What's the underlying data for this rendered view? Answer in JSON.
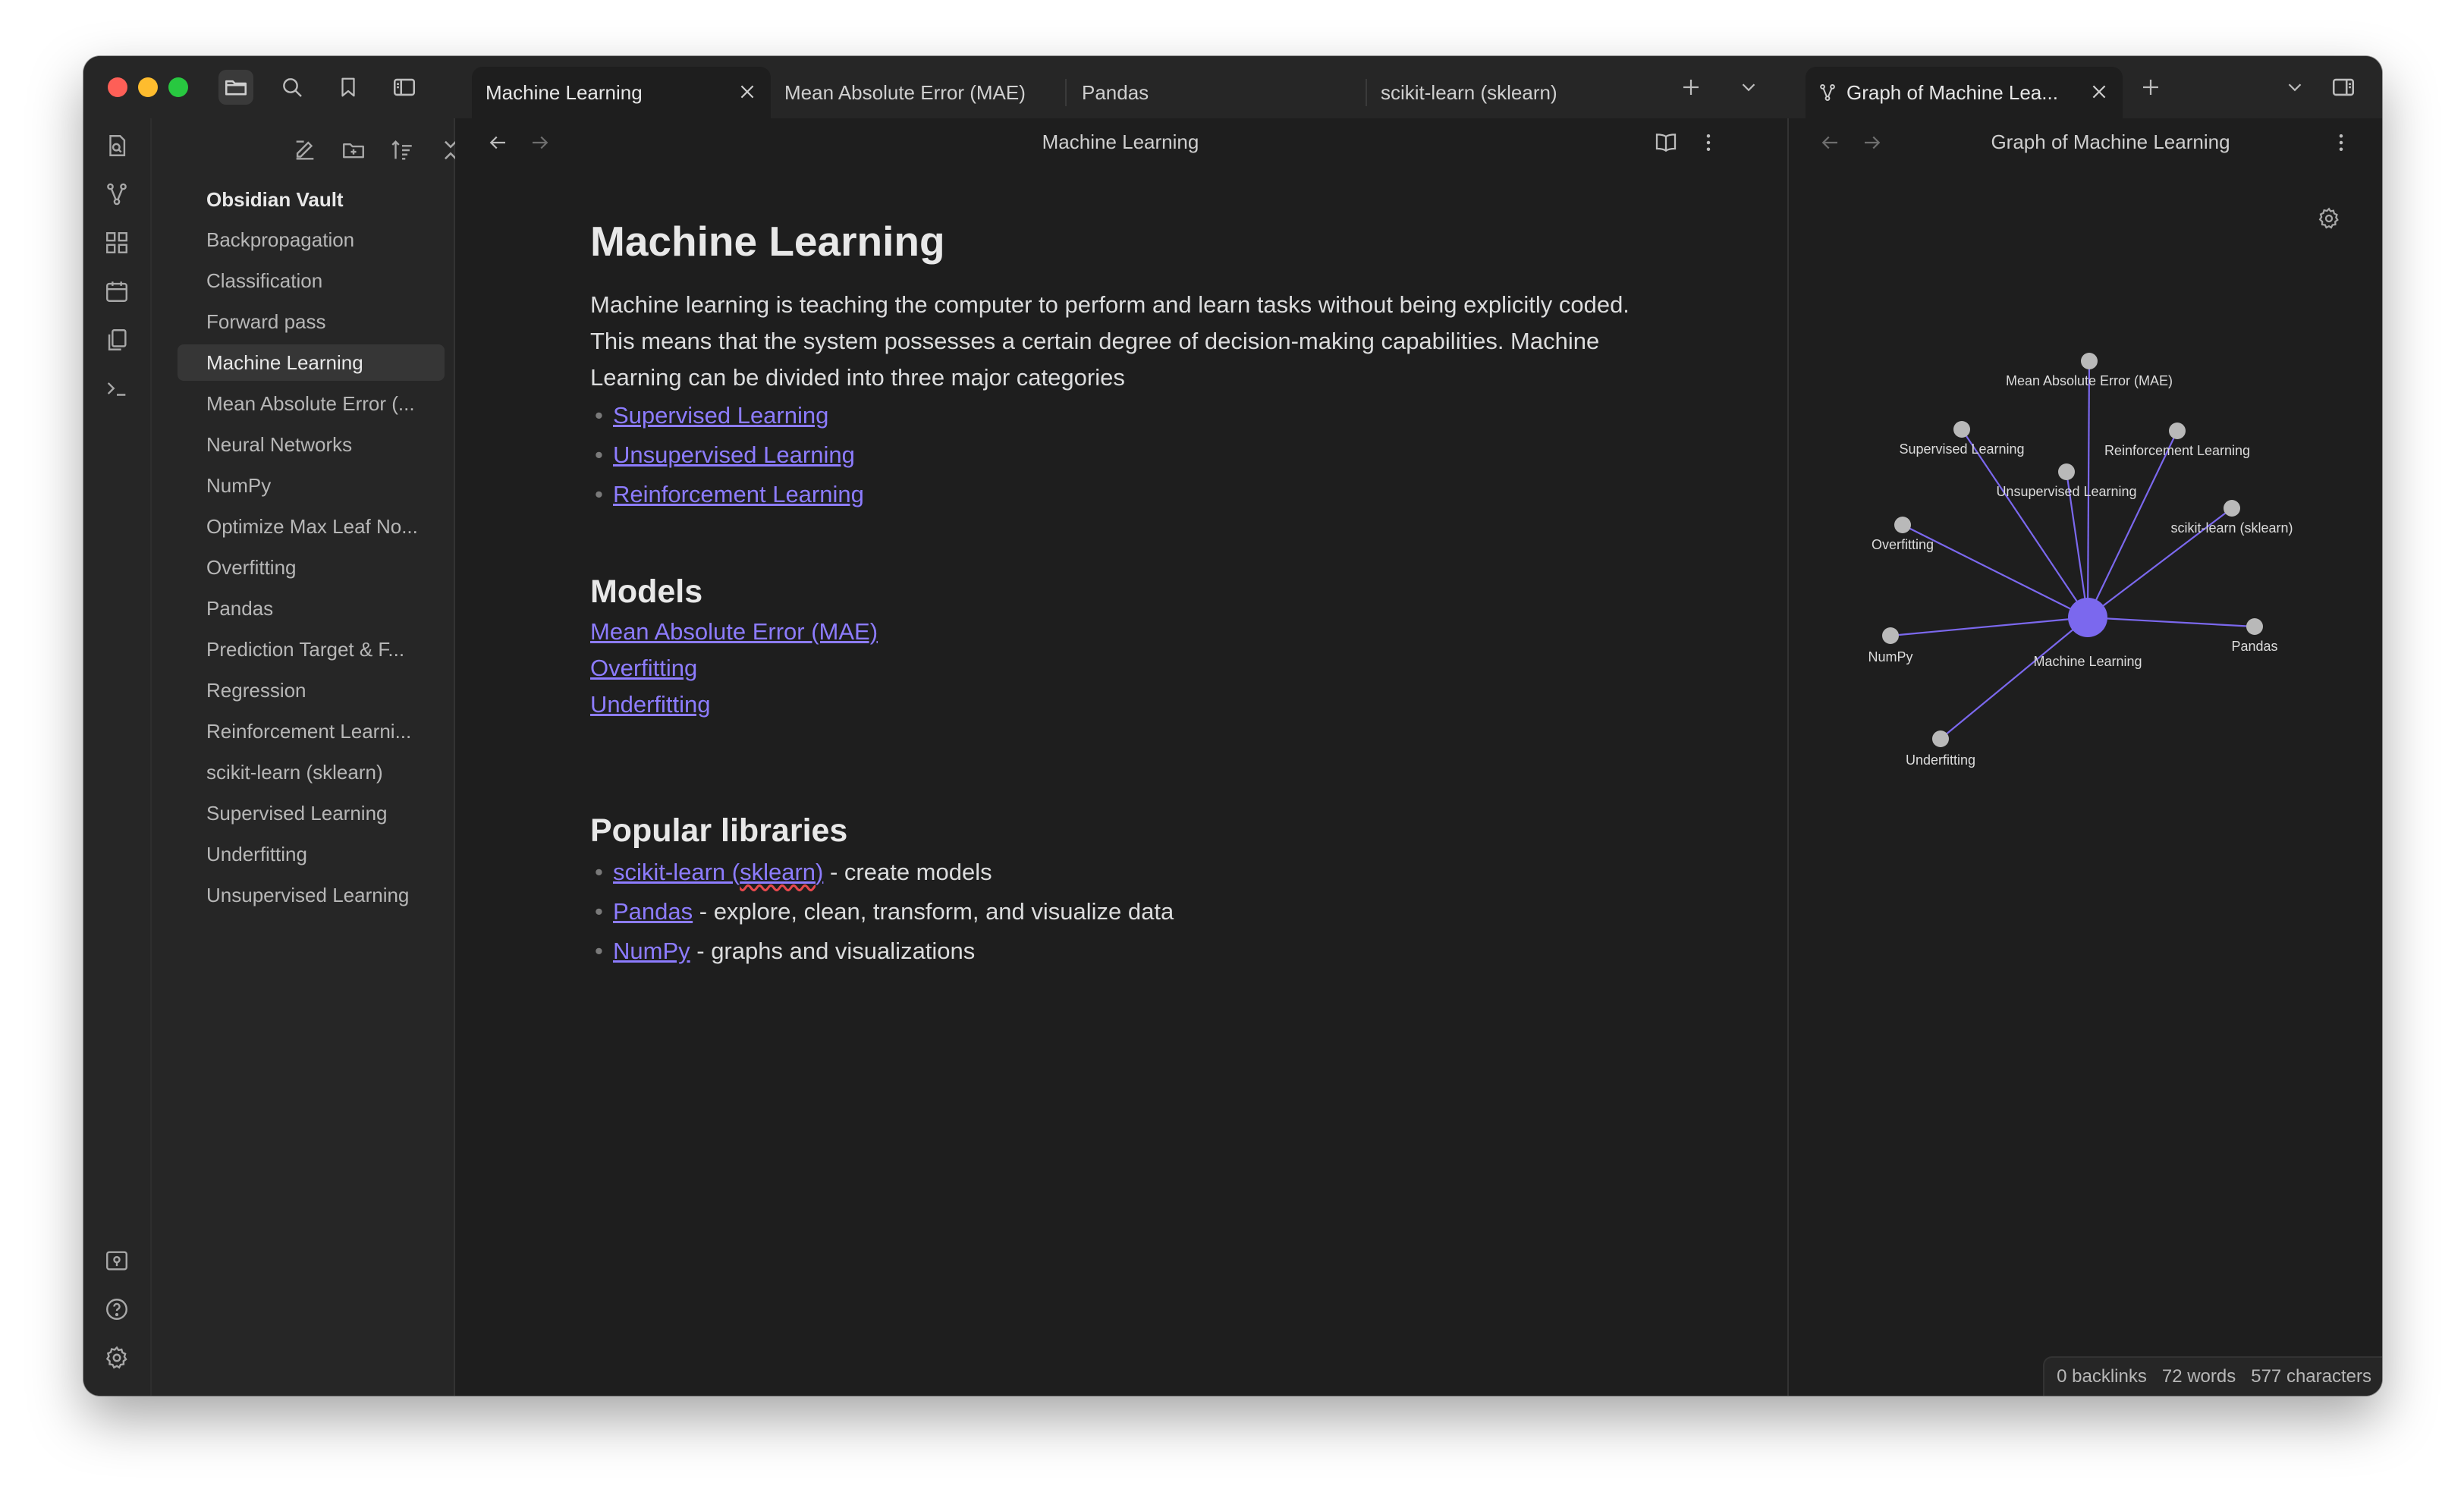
{
  "tabs": {
    "left": [
      {
        "label": "Machine Learning",
        "active": true
      },
      {
        "label": "Mean Absolute Error (MAE)"
      },
      {
        "label": "Pandas"
      },
      {
        "label": "scikit-learn (sklearn)"
      }
    ],
    "right": [
      {
        "label": "Graph of Machine Lea...",
        "active": true
      }
    ]
  },
  "sidebar": {
    "vault_name": "Obsidian Vault",
    "files": [
      {
        "label": "Backpropagation"
      },
      {
        "label": "Classification"
      },
      {
        "label": "Forward pass"
      },
      {
        "label": "Machine Learning",
        "active": true
      },
      {
        "label": "Mean Absolute Error (..."
      },
      {
        "label": "Neural Networks"
      },
      {
        "label": "NumPy"
      },
      {
        "label": "Optimize Max Leaf No..."
      },
      {
        "label": "Overfitting"
      },
      {
        "label": "Pandas"
      },
      {
        "label": "Prediction Target & F..."
      },
      {
        "label": "Regression"
      },
      {
        "label": "Reinforcement Learni..."
      },
      {
        "label": "scikit-learn (sklearn)"
      },
      {
        "label": "Supervised Learning"
      },
      {
        "label": "Underfitting"
      },
      {
        "label": "Unsupervised Learning"
      }
    ]
  },
  "editor": {
    "view_title": "Machine Learning",
    "note": {
      "title": "Machine Learning",
      "intro": "Machine learning is teaching the computer to perform and learn tasks without being explicitly coded. This means that the system possesses a certain degree of decision-making capabilities. Machine Learning can be divided into three major categories",
      "categories": [
        "Supervised Learning",
        "Unsupervised Learning",
        "Reinforcement Learning"
      ],
      "models_heading": "Models",
      "models": [
        "Mean Absolute Error (MAE)",
        "Overfitting",
        "Underfitting"
      ],
      "libraries_heading": "Popular libraries",
      "libraries": [
        {
          "link": "scikit-learn (sklearn)",
          "desc": " - create models"
        },
        {
          "link": "Pandas",
          "desc": " - explore, clean, transform, and visualize data"
        },
        {
          "link": "NumPy",
          "desc": " - graphs and visualizations"
        }
      ]
    }
  },
  "graph": {
    "view_title": "Graph of Machine Learning",
    "center": "Machine Learning",
    "nodes": [
      "Mean Absolute Error (MAE)",
      "Supervised Learning",
      "Reinforcement Learning",
      "Unsupervised Learning",
      "scikit-learn (sklearn)",
      "Overfitting",
      "NumPy",
      "Pandas",
      "Underfitting"
    ],
    "accent": "#7b68ee"
  },
  "status": {
    "backlinks": "0 backlinks",
    "words": "72 words",
    "characters": "577 characters"
  },
  "colors": {
    "accent": "#8d7cff",
    "background": "#1e1e1e"
  }
}
